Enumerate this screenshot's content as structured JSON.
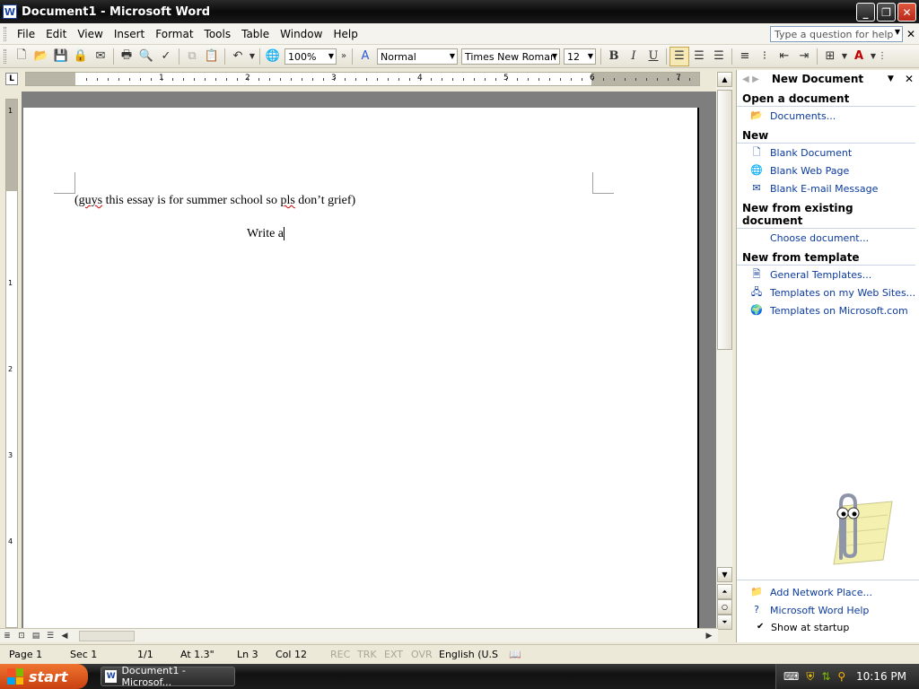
{
  "window": {
    "title": "Document1 - Microsoft Word",
    "app_icon": "W"
  },
  "menu": {
    "items": [
      "File",
      "Edit",
      "View",
      "Insert",
      "Format",
      "Tools",
      "Table",
      "Window",
      "Help"
    ],
    "help_placeholder": "Type a question for help"
  },
  "toolbar": {
    "zoom": "100%",
    "style": "Normal",
    "font": "Times New Roman",
    "size": "12",
    "bold": "B",
    "italic": "I",
    "underline": "U"
  },
  "document": {
    "line1_prefix": "(",
    "line1_word_guys": "guys",
    "line1_mid": " this essay is for summer school so ",
    "line1_word_pls": "pls",
    "line1_suffix": " don’t grief)",
    "line2": "Write a"
  },
  "taskpane": {
    "title": "New Document",
    "sections": {
      "open": "Open a document",
      "new": "New",
      "existing": "New from existing document",
      "template": "New from template"
    },
    "links": {
      "documents": "Documents...",
      "blank_document": "Blank Document",
      "blank_web_page": "Blank Web Page",
      "blank_email": "Blank E-mail Message",
      "choose_document": "Choose document...",
      "general_templates": "General Templates...",
      "templates_web_sites": "Templates on my Web Sites...",
      "templates_microsoft": "Templates on Microsoft.com",
      "add_network_place": "Add Network Place...",
      "word_help": "Microsoft Word Help",
      "show_at_startup": "Show at startup"
    }
  },
  "statusbar": {
    "page": "Page 1",
    "sec": "Sec 1",
    "pages": "1/1",
    "at": "At 1.3\"",
    "ln": "Ln 3",
    "col": "Col 12",
    "rec": "REC",
    "trk": "TRK",
    "ext": "EXT",
    "ovr": "OVR",
    "language": "English (U.S"
  },
  "taskbar": {
    "start": "start",
    "task": "Document1 - Microsof...",
    "clock": "10:16 PM"
  },
  "ruler": {
    "numbers": [
      "1",
      "2",
      "3",
      "4",
      "5",
      "6",
      "7"
    ],
    "vnumbers": [
      "1",
      "1",
      "2",
      "3",
      "4"
    ]
  }
}
